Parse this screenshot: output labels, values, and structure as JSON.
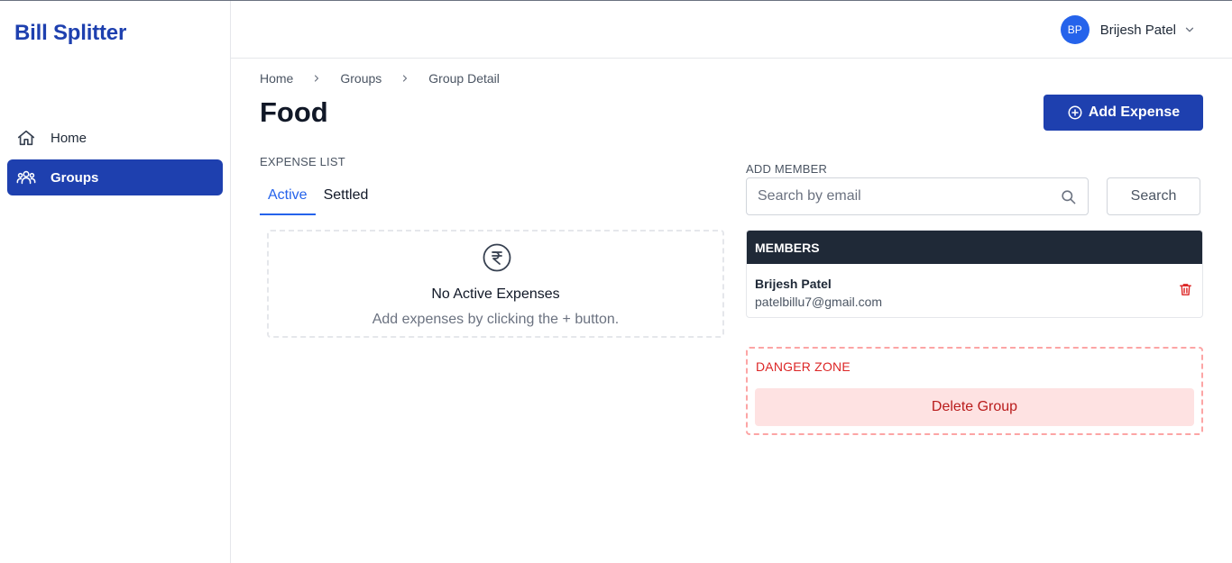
{
  "app": {
    "brand": "Bill Splitter",
    "accent": "#1e40af"
  },
  "sidebar": {
    "items": [
      {
        "label": "Home",
        "icon": "home-icon",
        "active": false
      },
      {
        "label": "Groups",
        "icon": "users-icon",
        "active": true
      }
    ]
  },
  "header": {
    "user": {
      "initials": "BP",
      "name": "Brijesh Patel"
    }
  },
  "breadcrumb": [
    "Home",
    "Groups",
    "Group Detail"
  ],
  "page": {
    "title": "Food",
    "add_expense_label": "Add Expense"
  },
  "expenses": {
    "section_label": "EXPENSE LIST",
    "tabs": [
      {
        "label": "Active",
        "active": true
      },
      {
        "label": "Settled",
        "active": false
      }
    ],
    "empty": {
      "icon": "rupee-icon",
      "title": "No Active Expenses",
      "subtitle": "Add expenses by clicking the + button."
    }
  },
  "add_member": {
    "section_label": "ADD MEMBER",
    "placeholder": "Search by email",
    "value": "",
    "search_button": "Search"
  },
  "members": {
    "header": "MEMBERS",
    "list": [
      {
        "name": "Brijesh Patel",
        "email": "patelbillu7@gmail.com"
      }
    ]
  },
  "danger_zone": {
    "title": "DANGER ZONE",
    "delete_label": "Delete Group",
    "color": "#dc2626"
  }
}
